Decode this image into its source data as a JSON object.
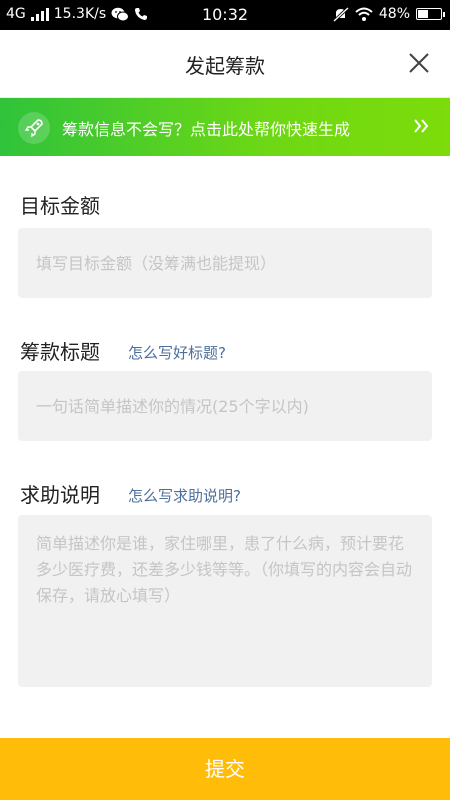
{
  "status_bar": {
    "network": "4G",
    "speed": "15.3K/s",
    "time": "10:32",
    "battery_text": "48%",
    "battery_level": 0.48,
    "icons": [
      "signal-icon",
      "wechat-icon",
      "phone-icon",
      "mute-icon",
      "wifi-icon",
      "battery-icon"
    ]
  },
  "header": {
    "title": "发起筹款",
    "close_icon": "close-icon"
  },
  "banner": {
    "text": "筹款信息不会写？点击此处帮你快速生成",
    "icon": "rocket-icon",
    "arrow_icon": "double-chevron-right-icon",
    "colors": {
      "start": "#2fc33b",
      "end": "#7ddc0a"
    }
  },
  "form": {
    "target_amount": {
      "label": "目标金额",
      "placeholder": "填写目标金额（没筹满也能提现）"
    },
    "title": {
      "label": "筹款标题",
      "help": "怎么写好标题?",
      "placeholder": "一句话简单描述你的情况(25个字以内)"
    },
    "description": {
      "label": "求助说明",
      "help": "怎么写求助说明?",
      "placeholder": "简单描述你是谁，家住哪里，患了什么病，预计要花多少医疗费，还差多少钱等等。（你填写的内容会自动保存，请放心填写）"
    }
  },
  "footer": {
    "submit_label": "提交",
    "color": "#ffbd0a"
  },
  "colors": {
    "link": "#4c6f9b",
    "field_bg": "#f1f1f1"
  }
}
